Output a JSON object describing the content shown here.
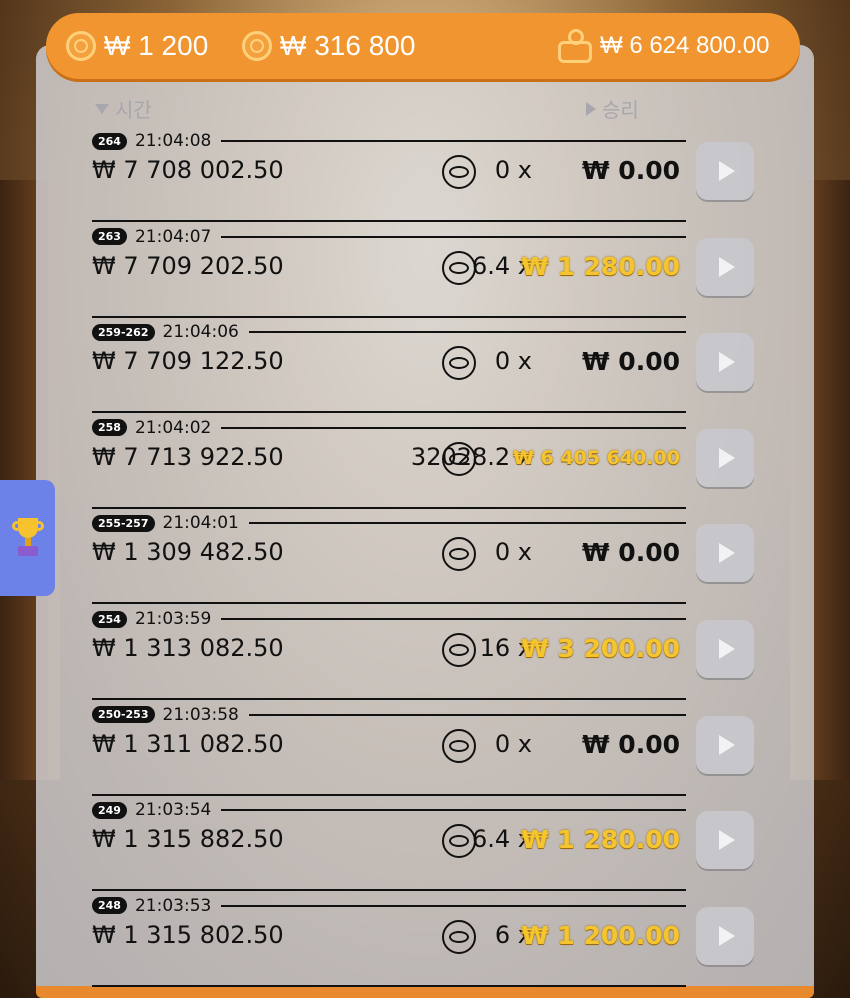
{
  "header": {
    "bet_amount": "₩ 1 200",
    "total_win": "₩ 316 800",
    "balance": "₩ 6 624 800.00"
  },
  "columns": {
    "time_label": "시간",
    "win_label": "승리"
  },
  "rows": [
    {
      "round": "264",
      "time": "21:04:08",
      "bet": "₩ 7 708 002.50",
      "mult": "0 x",
      "win": "₩ 0.00",
      "win_style": "zero"
    },
    {
      "round": "263",
      "time": "21:04:07",
      "bet": "₩ 7 709 202.50",
      "mult": "6.4 x",
      "win": "₩ 1 280.00",
      "win_style": "gold"
    },
    {
      "round": "259-262",
      "time": "21:04:06",
      "bet": "₩ 7 709 122.50",
      "mult": "0 x",
      "win": "₩ 0.00",
      "win_style": "zero"
    },
    {
      "round": "258",
      "time": "21:04:02",
      "bet": "₩ 7 713 922.50",
      "mult": "32028.2 x",
      "win": "₩ 6 405 640.00",
      "win_style": "gold small"
    },
    {
      "round": "255-257",
      "time": "21:04:01",
      "bet": "₩ 1 309 482.50",
      "mult": "0 x",
      "win": "₩ 0.00",
      "win_style": "zero"
    },
    {
      "round": "254",
      "time": "21:03:59",
      "bet": "₩ 1 313 082.50",
      "mult": "16 x",
      "win": "₩ 3 200.00",
      "win_style": "gold"
    },
    {
      "round": "250-253",
      "time": "21:03:58",
      "bet": "₩ 1 311 082.50",
      "mult": "0 x",
      "win": "₩ 0.00",
      "win_style": "zero"
    },
    {
      "round": "249",
      "time": "21:03:54",
      "bet": "₩ 1 315 882.50",
      "mult": "6.4 x",
      "win": "₩ 1 280.00",
      "win_style": "gold"
    },
    {
      "round": "248",
      "time": "21:03:53",
      "bet": "₩ 1 315 802.50",
      "mult": "6 x",
      "win": "₩ 1 200.00",
      "win_style": "gold"
    }
  ],
  "colors": {
    "header_orange": "#f0952f",
    "win_gold": "#f4c52e",
    "leaderboard_tab": "#6c82e8"
  },
  "icons": {
    "coin": "coin-icon",
    "wallet": "wallet-icon",
    "play": "play-icon",
    "trophy": "trophy-icon"
  }
}
